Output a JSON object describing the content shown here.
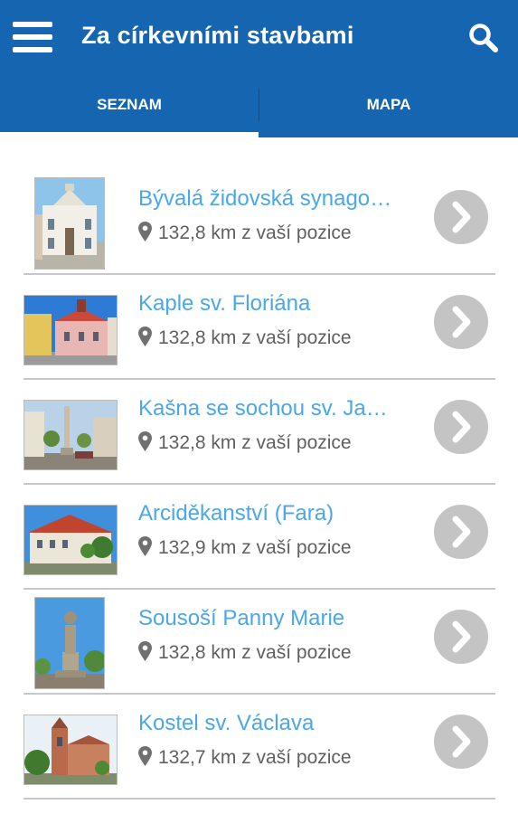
{
  "appbar": {
    "title": "Za církevními stavbami",
    "menu_icon": "hamburger-menu-icon",
    "search_icon": "search-icon",
    "color": "#1565b0"
  },
  "tabs": [
    {
      "label": "SEZNAM",
      "selected": true
    },
    {
      "label": "MAPA",
      "selected": false
    }
  ],
  "list": {
    "items": [
      {
        "title": "Bývalá židovská synago…",
        "distance": "132,8 km z vaší pozice"
      },
      {
        "title": "Kaple sv. Floriána",
        "distance": "132,8 km z vaší pozice"
      },
      {
        "title": "Kašna se sochou sv. Ja…",
        "distance": "132,8 km z vaší pozice"
      },
      {
        "title": "Arciděkanství (Fara)",
        "distance": "132,9 km z vaší pozice"
      },
      {
        "title": "Sousoší Panny Marie",
        "distance": "132,8 km z vaší pozice"
      },
      {
        "title": "Kostel sv. Václava",
        "distance": "132,7 km z vaší pozice"
      }
    ],
    "title_color": "#4aa7e8",
    "pin_icon": "map-pin-icon",
    "chevron_icon": "chevron-right-icon"
  }
}
